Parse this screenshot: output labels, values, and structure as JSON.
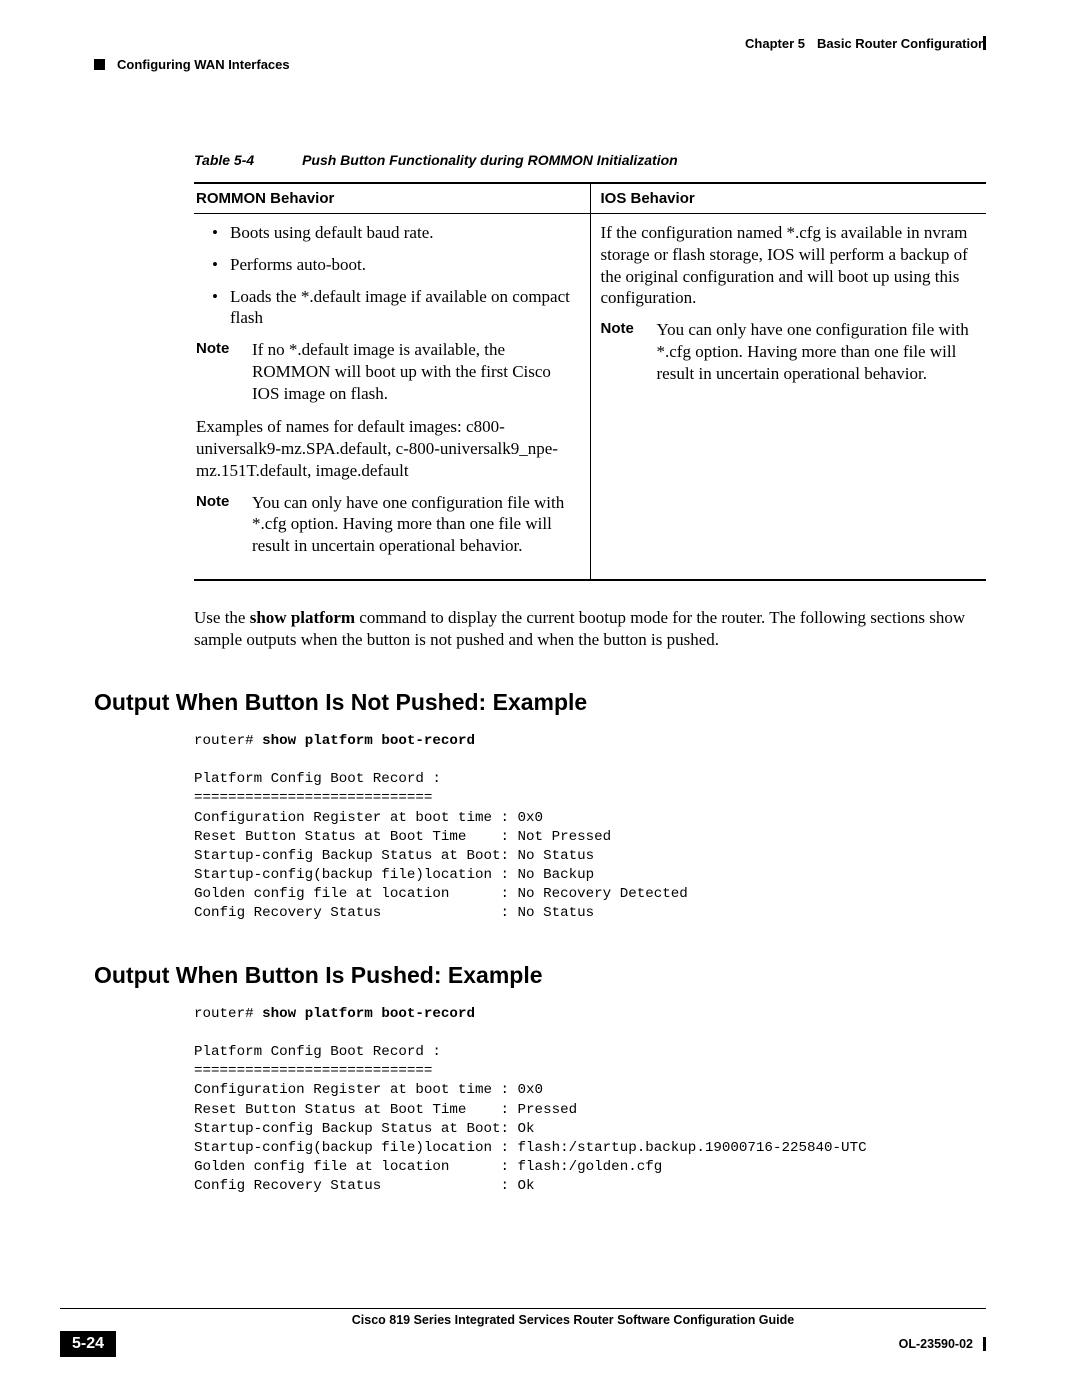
{
  "header": {
    "chapter_label": "Chapter 5",
    "chapter_title": "Basic Router Configuration",
    "section": "Configuring WAN Interfaces"
  },
  "table": {
    "caption_label": "Table 5-4",
    "caption_title": "Push Button Functionality during ROMMON Initialization",
    "col1_header": "ROMMON Behavior",
    "col2_header": "IOS Behavior",
    "col1": {
      "bullets": [
        "Boots using default baud rate.",
        "Performs auto-boot.",
        "Loads the *.default image if available on compact flash"
      ],
      "note1_label": "Note",
      "note1_text": "If no *.default image is available, the ROMMON will boot up with the first Cisco IOS image on flash.",
      "para": "Examples of names for default images: c800-universalk9-mz.SPA.default, c-800-universalk9_npe-mz.151T.default, image.default",
      "note2_label": "Note",
      "note2_text": "You can only have one configuration file with *.cfg option. Having more than one file will result in uncertain operational behavior."
    },
    "col2": {
      "para": "If the configuration named *.cfg is available in nvram storage or flash storage, IOS will perform a backup of the original configuration and will boot up using this configuration.",
      "note_label": "Note",
      "note_text": "You can only have one configuration file with *.cfg option. Having more than one file will result in uncertain operational behavior."
    }
  },
  "body": {
    "use_prefix": "Use the ",
    "cmd": "show platform",
    "use_suffix": " command to display the current bootup mode for the router. The following sections show sample outputs when the button is not pushed and when the button is pushed."
  },
  "section1": {
    "title": "Output When Button Is Not Pushed: Example",
    "prompt": "router# ",
    "cmd": "show platform boot-record",
    "output": "Platform Config Boot Record :\n============================\nConfiguration Register at boot time : 0x0\nReset Button Status at Boot Time    : Not Pressed\nStartup-config Backup Status at Boot: No Status\nStartup-config(backup file)location : No Backup\nGolden config file at location      : No Recovery Detected\nConfig Recovery Status              : No Status"
  },
  "section2": {
    "title": "Output When Button Is Pushed: Example",
    "prompt": "router# ",
    "cmd": "show platform boot-record",
    "output": "Platform Config Boot Record :\n============================\nConfiguration Register at boot time : 0x0\nReset Button Status at Boot Time    : Pressed\nStartup-config Backup Status at Boot: Ok\nStartup-config(backup file)location : flash:/startup.backup.19000716-225840-UTC\nGolden config file at location      : flash:/golden.cfg\nConfig Recovery Status              : Ok"
  },
  "footer": {
    "book_title": "Cisco 819 Series Integrated Services Router Software Configuration Guide",
    "page_number": "5-24",
    "doc_id": "OL-23590-02"
  }
}
